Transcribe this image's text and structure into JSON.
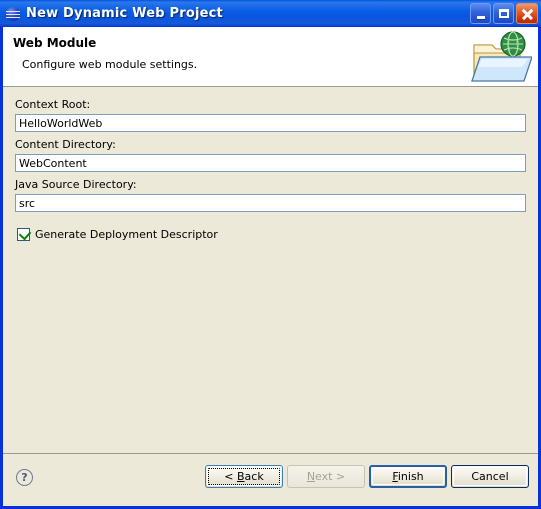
{
  "window": {
    "title": "New Dynamic Web Project",
    "icon": "eclipse-globe-icon",
    "controls": {
      "minimize": "Minimize",
      "maximize": "Maximize",
      "close": "Close"
    }
  },
  "header": {
    "title": "Web Module",
    "description": "Configure web module settings.",
    "banner_icon": "web-folder-globe-icon"
  },
  "form": {
    "fields": [
      {
        "label": "Context Root:",
        "value": "HelloWorldWeb",
        "name": "context-root"
      },
      {
        "label": "Content Directory:",
        "value": "WebContent",
        "name": "content-directory"
      },
      {
        "label": "Java Source Directory:",
        "value": "src",
        "name": "java-source-directory"
      }
    ],
    "checkbox": {
      "label": "Generate Deployment Descriptor",
      "checked": true
    }
  },
  "footer": {
    "help_glyph": "?",
    "help_name": "help-icon",
    "buttons": [
      {
        "name": "back-button",
        "label_pre": "< ",
        "label_acc": "B",
        "label_post": "ack",
        "state": "focused",
        "enabled": true
      },
      {
        "name": "next-button",
        "label_pre": "",
        "label_acc": "N",
        "label_post": "ext >",
        "state": "disabled",
        "enabled": false
      },
      {
        "name": "finish-button",
        "label_pre": "",
        "label_acc": "F",
        "label_post": "inish",
        "state": "default",
        "enabled": true
      },
      {
        "name": "cancel-button",
        "label_pre": "",
        "label_acc": "",
        "label_post": "Cancel",
        "state": "normal",
        "enabled": true
      }
    ]
  },
  "colors": {
    "titlebar_blue": "#0a54e0",
    "window_border": "#0831d9",
    "dialog_bg": "#ece9d8",
    "header_bg": "#ffffff",
    "input_border": "#7f9db9",
    "check_green": "#108010"
  }
}
